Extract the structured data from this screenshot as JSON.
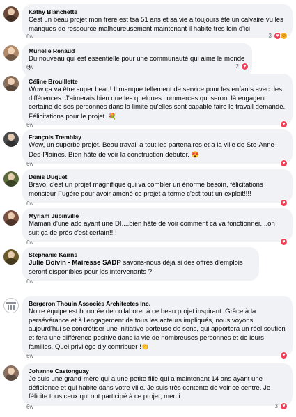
{
  "comments": [
    {
      "author": "Kathy Blanchette",
      "text": "Cest un beau projet mon frere est tsa 51 ans et sa vie a toujours été un calvaire vu les manques de ressource malheureusement maintenant il habite tres loin d'ici",
      "time": "6w",
      "reactions": {
        "count": "3",
        "icons": [
          "heart-icon",
          "care-icon"
        ]
      },
      "avatar_color": "#6b4a3a"
    },
    {
      "author": "Murielle Renaud",
      "text": "Du nouveau qui est essentielle pour une communauté qui aime le monde !",
      "time": "6w",
      "reactions": {
        "count": "2",
        "icons": [
          "heart-icon"
        ]
      },
      "avatar_color": "#b08a6a"
    },
    {
      "author": "Céline Brouillette",
      "text": "Wow ça va être super beau! Il manque tellement de service pour les enfants avec des différences. J'aimerais bien que les quelques commerces qui seront là engagent certaine de ses personnes dans la limite qu'elles sont capable faire le travail demandé. Félicitations pour le projet.",
      "emoji": "💐",
      "time": "6w",
      "reactions": {
        "count": "",
        "icons": [
          "heart-icon"
        ]
      },
      "avatar_color": "#8a6f5a"
    },
    {
      "author": "François Tremblay",
      "text": "Wow, un superbe projet. Beau travail a tout les partenaires et a la ville de Ste-Anne-Des-Plaines. Bien hâte de voir la construction débuter.",
      "emoji": "😍",
      "time": "6w",
      "reactions": {
        "count": "",
        "icons": [
          "heart-icon"
        ]
      },
      "avatar_color": "#4a4a4a"
    },
    {
      "author": "Denis Duquet",
      "text": "Bravo, c'est un projet magnifique qui va combler un énorme besoin, félicitations monsieur Fugère pour avoir amené ce projet à terme c'est tout un exploit!!!!",
      "time": "6w",
      "reactions": {
        "count": "",
        "icons": [
          "heart-icon"
        ]
      },
      "avatar_color": "#5b6a3a"
    },
    {
      "author": "Myriam Jubinville",
      "text": "Maman d'une ado ayant une DI....bien hâte de voir comment ca va fonctionner....on suit ça de près c'est certain!!!!",
      "time": "6w",
      "reactions": {
        "count": "",
        "icons": [
          "heart-icon"
        ]
      },
      "avatar_color": "#7a5040"
    },
    {
      "author": "Stéphanie Kairns",
      "mention": "Julie Boivin - Mairesse SADP",
      "text": " savons-nous déjà si des offres d'emplois seront disponibles pour les intervenants ?",
      "time": "6w",
      "reactions": {
        "count": "",
        "icons": []
      },
      "avatar_color": "#6a5a2a"
    },
    {
      "author": "Bergeron Thouin Associés Architectes Inc.",
      "text": "Notre équipe est honorée de collaborer à ce beau projet inspirant. Grâce à la persévérance et à l'engagement de tous les acteurs impliqués, nous voyons aujourd'hui se concrétiser une initiative porteuse de sens, qui apportera un réel soutien et fera une différence positive dans la vie de nombreuses personnes et de leurs familles. Quel privilège d'y contribuer !",
      "emoji": "👏",
      "time": "6w",
      "reactions": {
        "count": "",
        "icons": [
          "heart-icon"
        ]
      },
      "avatar_color": "#ffffff"
    },
    {
      "author": "Johanne Castonguay",
      "text": "Je suis une grand-mère qui a une petite fille qui a maintenant 14 ans ayant une déficience et qui habite dans votre ville. Je suis très contente de voir ce centre. Je félicite tous ceux qui ont participé à ce projet, merci",
      "time": "6w",
      "reactions": {
        "count": "3",
        "icons": [
          "heart-icon"
        ]
      },
      "avatar_color": "#8a7060"
    }
  ]
}
